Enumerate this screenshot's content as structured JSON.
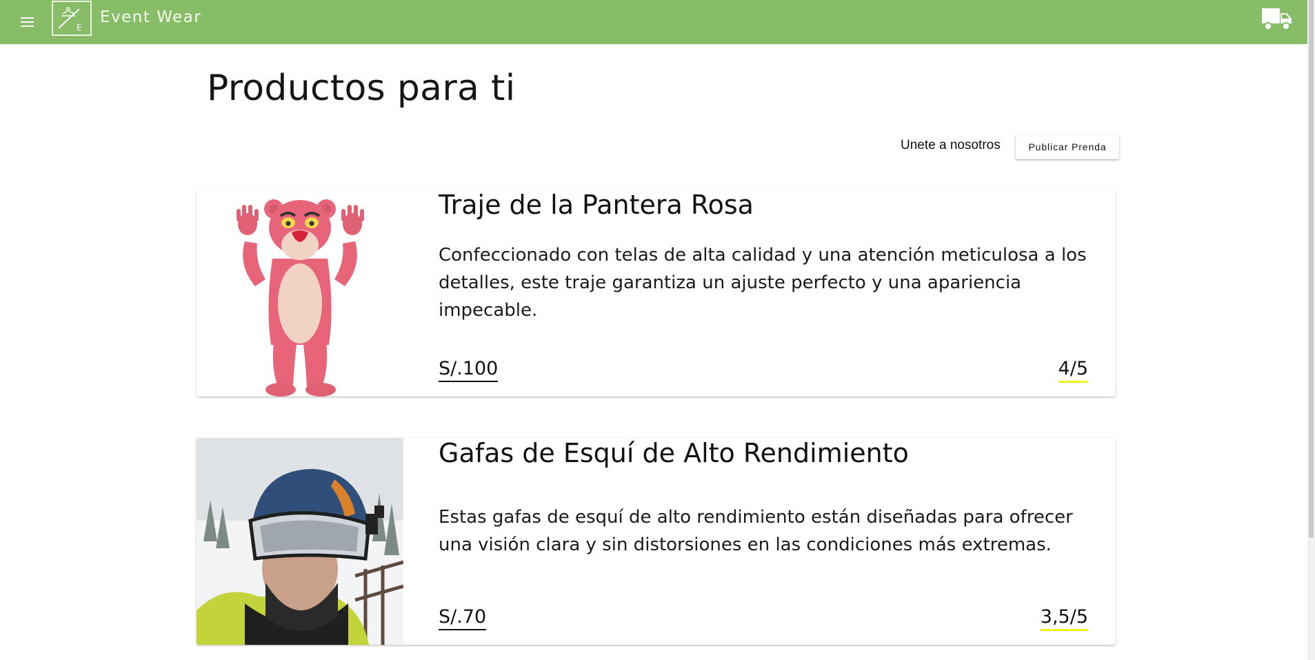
{
  "app": {
    "brand": "Event Wear",
    "logo_letter": "E",
    "bar_color": "#86bd66"
  },
  "icons": {
    "menu": "menu-icon",
    "logo": "hanger-icon",
    "cart": "truck-icon"
  },
  "page": {
    "title": "Productos para ti"
  },
  "actions": {
    "join_text": "Unete a nosotros",
    "publish_label": "Publicar Prenda"
  },
  "products": [
    {
      "title": "Traje de la Pantera Rosa",
      "description": "Confeccionado con telas de alta calidad y una atención meticulosa a los detalles, este traje garantiza un ajuste perfecto y una apariencia impecable.",
      "price": "S/.100",
      "rating": "4/5",
      "image": "pink-panther-costume"
    },
    {
      "title": "Gafas de Esquí de Alto Rendimiento",
      "description": "Estas gafas de esquí de alto rendimiento están diseñadas para ofrecer una visión clara y sin distorsiones en las condiciones más extremas.",
      "price": "S/.70",
      "rating": "3,5/5",
      "image": "ski-goggles-selfie"
    }
  ],
  "colors": {
    "rating_underline": "#f2f21a",
    "price_underline": "#111111"
  }
}
